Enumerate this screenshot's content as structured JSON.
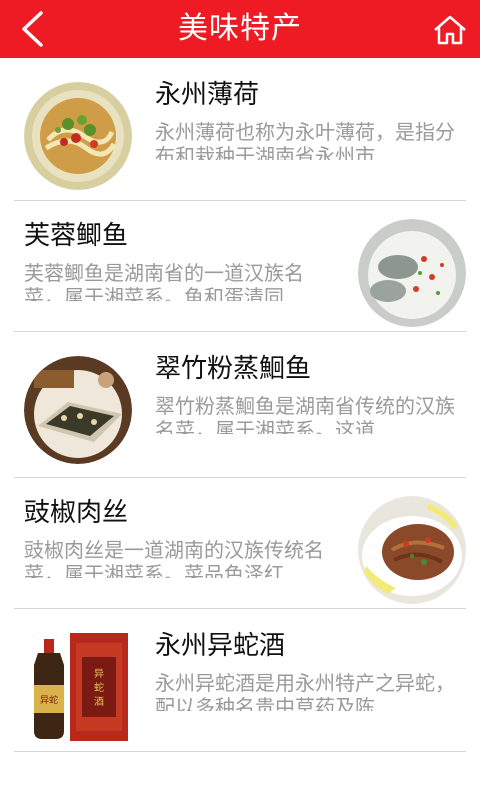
{
  "header": {
    "title": "美味特产",
    "back_icon": "chevron-left-icon",
    "home_icon": "home-icon",
    "bg_color": "#ee1b24"
  },
  "items": [
    {
      "name": "永州薄荷",
      "desc": "永州薄荷也称为永叶薄荷，是指分布和栽种于湖南省永州市",
      "image": "noodle-soup-image"
    },
    {
      "name": "芙蓉鲫鱼",
      "desc": "芙蓉鲫鱼是湖南省的一道汉族名菜，属于湘菜系。鱼和蛋清同",
      "image": "steamed-fish-egg-image"
    },
    {
      "name": "翠竹粉蒸鮰鱼",
      "desc": "翠竹粉蒸鮰鱼是湖南省传统的汉族名菜，属于湘菜系。这道",
      "image": "steamed-catfish-image"
    },
    {
      "name": "豉椒肉丝",
      "desc": "豉椒肉丝是一道湖南的汉族传统名菜，属于湘菜系。菜品色泽红",
      "image": "shredded-pork-image"
    },
    {
      "name": "永州异蛇酒",
      "desc": "永州异蛇酒是用永州特产之异蛇，配以多种名贵中草药及陈",
      "image": "snake-wine-bottle-image"
    }
  ]
}
